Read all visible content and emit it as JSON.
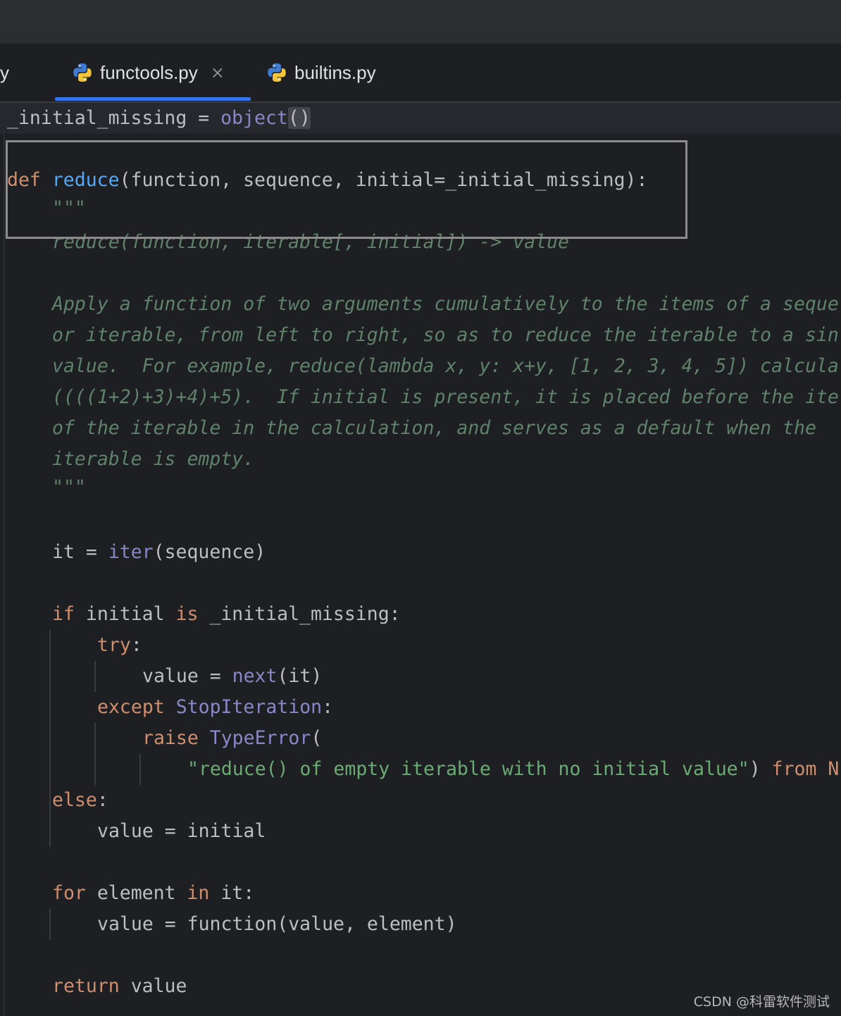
{
  "tabs": {
    "cut_label": "y",
    "active_label": "functools.py",
    "close_glyph": "×",
    "other_label": "builtins.py"
  },
  "code": {
    "l0_a": "_initial_missing = ",
    "l0_b": "object",
    "l0_c": "()",
    "l1_kw": "def",
    "l1_fn": "reduce",
    "l1_rest": "(function, sequence, initial=_initial_missing):",
    "l2": "\"\"\"",
    "l3": "reduce(function, iterable[, initial]) -> value",
    "l5": "Apply a function of two arguments cumulatively to the items of a seque",
    "l6": "or iterable, from left to right, so as to reduce the iterable to a sin",
    "l7": "value.  For example, reduce(lambda x, y: x+y, [1, 2, 3, 4, 5]) calcula",
    "l8": "((((1+2)+3)+4)+5).  If initial is present, it is placed before the ite",
    "l9": "of the iterable in the calculation, and serves as a default when the",
    "l10": "iterable is empty.",
    "l11": "\"\"\"",
    "l14_a": "it = ",
    "l14_b": "iter",
    "l14_c": "(sequence)",
    "l16_kw1": "if",
    "l16_a": " initial ",
    "l16_kw2": "is",
    "l16_b": " _initial_missing:",
    "l17_kw": "try",
    "l17_b": ":",
    "l18_a": "value = ",
    "l18_b": "next",
    "l18_c": "(it)",
    "l19_kw": "except",
    "l19_b": "StopIteration",
    "l19_c": ":",
    "l20_kw": "raise",
    "l20_b": "TypeError",
    "l20_c": "(",
    "l21_str": "\"reduce() of empty iterable with no initial value\"",
    "l21_b": ") ",
    "l21_kw": "from",
    "l21_c": " N",
    "l22_kw": "else",
    "l22_b": ":",
    "l23": "value = initial",
    "l25_kw1": "for",
    "l25_a": " element ",
    "l25_kw2": "in",
    "l25_b": " it:",
    "l26": "value = function(value, element)",
    "l28_kw": "return",
    "l28_b": " value"
  },
  "watermark": "CSDN @科雷软件测试",
  "colors": {
    "keyword": "#cf8e6d",
    "function_name": "#56a8f5",
    "builtin": "#8888c6",
    "string": "#6aab73",
    "docstring": "#5f826b",
    "text": "#bcbec4",
    "tab_accent": "#3574f0"
  }
}
